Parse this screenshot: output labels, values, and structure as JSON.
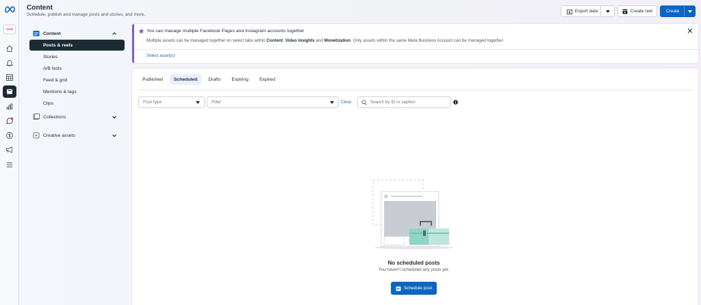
{
  "brand": {
    "account_badge": "OOM"
  },
  "header": {
    "title": "Content",
    "subtitle": "Schedule, publish and manage posts and stories, and more.",
    "export_label": "Export data",
    "create_reel_label": "Create reel",
    "create_label": "Create"
  },
  "rail": {
    "icons": [
      "home-icon",
      "notifications-icon",
      "planner-icon",
      "content-icon",
      "insights-icon",
      "inbox-icon",
      "monetization-icon",
      "ads-icon",
      "menu-icon"
    ]
  },
  "sidebar": {
    "content": {
      "label": "Content",
      "items": [
        "Posts & reels",
        "Stories",
        "A/B tests",
        "Feed & grid",
        "Mentions & tags",
        "Clips"
      ]
    },
    "collections_label": "Collections",
    "creative_label": "Creative assets"
  },
  "banner": {
    "title": "You can manage multiple Facebook Pages and Instagram accounts together",
    "body_prefix": "Multiple assets can be managed together on select tabs within ",
    "bold1": "Content",
    "sep1": ", ",
    "bold2": "Video insights",
    "sep2": " and ",
    "bold3": "Monetization",
    "body_suffix": ". Only assets within the same Meta Business Account can be managed together.",
    "link": "Select asset(s)"
  },
  "tabs": [
    "Published",
    "Scheduled",
    "Drafts",
    "Expiring",
    "Expired"
  ],
  "filters": {
    "post_type_placeholder": "Post type",
    "filter_placeholder": "Filter",
    "clear_label": "Clear",
    "search_placeholder": "Search by ID or caption"
  },
  "empty": {
    "title": "No scheduled posts",
    "subtitle": "You haven't scheduled any posts yet.",
    "button_label": "Schedule post"
  },
  "colors": {
    "accent": "#0a66c2",
    "dark": "#1c2b33",
    "banner_accent": "#7b61c6"
  }
}
